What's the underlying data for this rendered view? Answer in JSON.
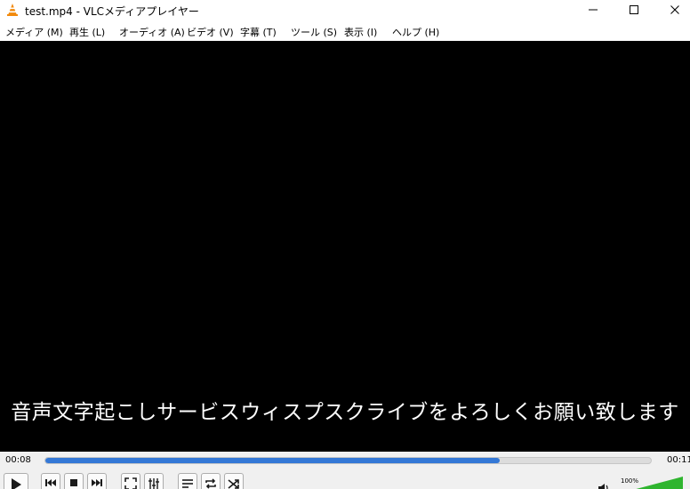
{
  "window": {
    "title": "test.mp4 - VLCメディアプレイヤー"
  },
  "menu": {
    "items": [
      {
        "label": "メディア (M)"
      },
      {
        "label": "再生 (L)"
      },
      {
        "label": "オーディオ (A)"
      },
      {
        "label": "ビデオ (V)"
      },
      {
        "label": "字幕 (T)"
      },
      {
        "label": "ツール (S)"
      },
      {
        "label": "表示 (I)"
      },
      {
        "label": "ヘルプ (H)"
      }
    ]
  },
  "video": {
    "subtitle": "音声文字起こしサービスウィスプスクライブをよろしくお願い致します"
  },
  "playback": {
    "elapsed": "00:08",
    "total": "00:11",
    "progress": 0.75
  },
  "volume": {
    "label": "100%",
    "level": 1.0
  },
  "icons": {
    "app": "vlc-cone-icon",
    "minimize": "minimize-icon",
    "maximize": "maximize-icon",
    "close": "close-icon",
    "play": "play-icon",
    "previous": "skip-previous-icon",
    "stop": "stop-icon",
    "next": "skip-next-icon",
    "fullscreen": "fullscreen-icon",
    "extended": "extended-settings-icon",
    "playlist": "playlist-icon",
    "loop": "loop-icon",
    "shuffle": "shuffle-icon",
    "volume": "speaker-icon"
  },
  "colors": {
    "accent": "#3478d6",
    "cone": "#f28a0c",
    "volume": "#2fb52f"
  }
}
